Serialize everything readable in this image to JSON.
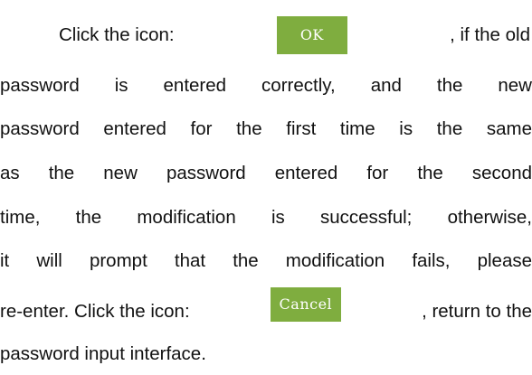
{
  "paragraph": {
    "line1": {
      "before": "Click the icon:",
      "after": ", if the old"
    },
    "line2": "password is entered correctly, and the new",
    "line3": "password entered for the first time is the same",
    "line4": "as the new password entered for the second",
    "line5": "time, the modification is successful; otherwise,",
    "line6": "it will prompt that the modification fails, please",
    "line7": {
      "before": "re-enter. Click the icon:",
      "after": ", return to the"
    },
    "line8": "password input interface."
  },
  "buttons": {
    "ok_label": "OK",
    "cancel_label": "Cancel",
    "color": "#7fad3f"
  }
}
